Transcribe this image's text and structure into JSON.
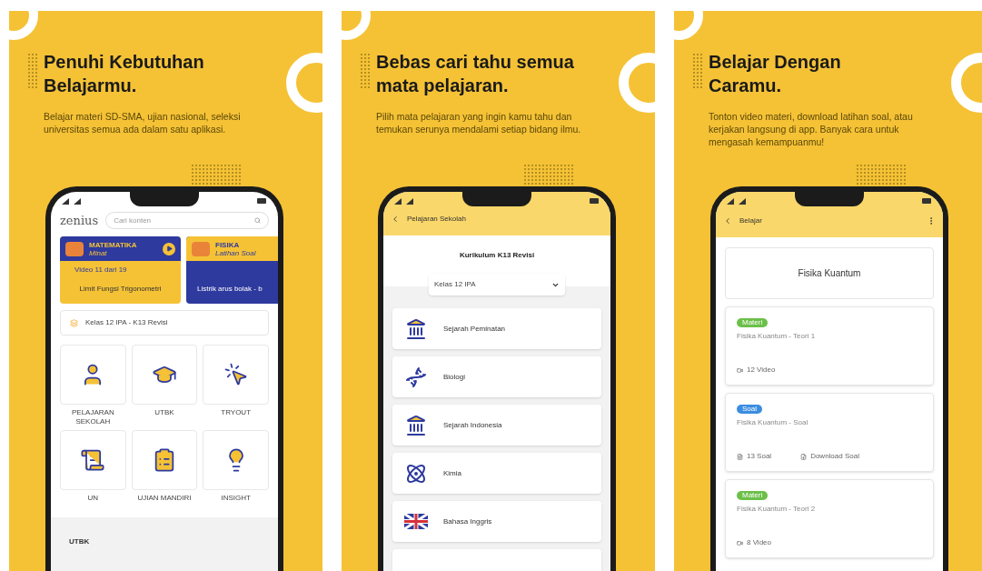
{
  "panels": [
    {
      "kind": "home",
      "heading": "Penuhi Kebutuhan Belajarmu.",
      "body": "Belajar materi SD-SMA, ujian nasional, seleksi universitas semua ada dalam satu aplikasi.",
      "screen": {
        "logo": "zenius",
        "search": {
          "placeholder": "Cari konten"
        },
        "banners": [
          {
            "kind": "video",
            "subject": "MATEMATIKA",
            "tag": "Minat",
            "progress": "Video 11 dari 19",
            "title": "Limit Fungsi Trigonometri"
          },
          {
            "kind": "practice",
            "subject": "FISIKA",
            "tag": "Latihan Soal",
            "title": "Listrik arus bolak - b"
          }
        ],
        "class_selector": "Kelas 12 IPA - K13 Revisi",
        "menu": [
          "PELAJARAN SEKOLAH",
          "UTBK",
          "TRYOUT",
          "UN",
          "UJIAN MANDIRI",
          "INSIGHT"
        ],
        "section": "UTBK"
      }
    },
    {
      "kind": "subjects",
      "heading": "Bebas cari tahu semua mata pelajaran.",
      "body": "Pilih mata pelajaran yang ingin kamu tahu dan temukan serunya mendalami setiap bidang ilmu.",
      "screen": {
        "title": "Pelajaran Sekolah",
        "curriculum": "Kurikulum K13 Revisi",
        "class_dropdown": "Kelas 12 IPA",
        "subjects": [
          "Sejarah Peminatan",
          "Biologi",
          "Sejarah Indonesia",
          "Kimia",
          "Bahasa Inggris"
        ]
      }
    },
    {
      "kind": "lessons",
      "heading": "Belajar Dengan Caramu.",
      "body": "Tonton video materi, download latihan soal, atau kerjakan langsung di app. Banyak cara untuk mengasah kemampuanmu!",
      "screen": {
        "title": "Belajar",
        "topic": "Fisika Kuantum",
        "items": [
          {
            "kind": "material",
            "tag": "Materi",
            "title": "Fisika Kuantum - Teori 1",
            "meta": [
              "12 Video"
            ]
          },
          {
            "kind": "quiz",
            "tag": "Soal",
            "title": "Fisika Kuantum - Soal",
            "meta": [
              "13 Soal",
              "Download Soal"
            ]
          },
          {
            "kind": "material",
            "tag": "Materi",
            "title": "Fisika Kuantum - Teori 2",
            "meta": [
              "8 Video"
            ]
          }
        ]
      }
    }
  ]
}
